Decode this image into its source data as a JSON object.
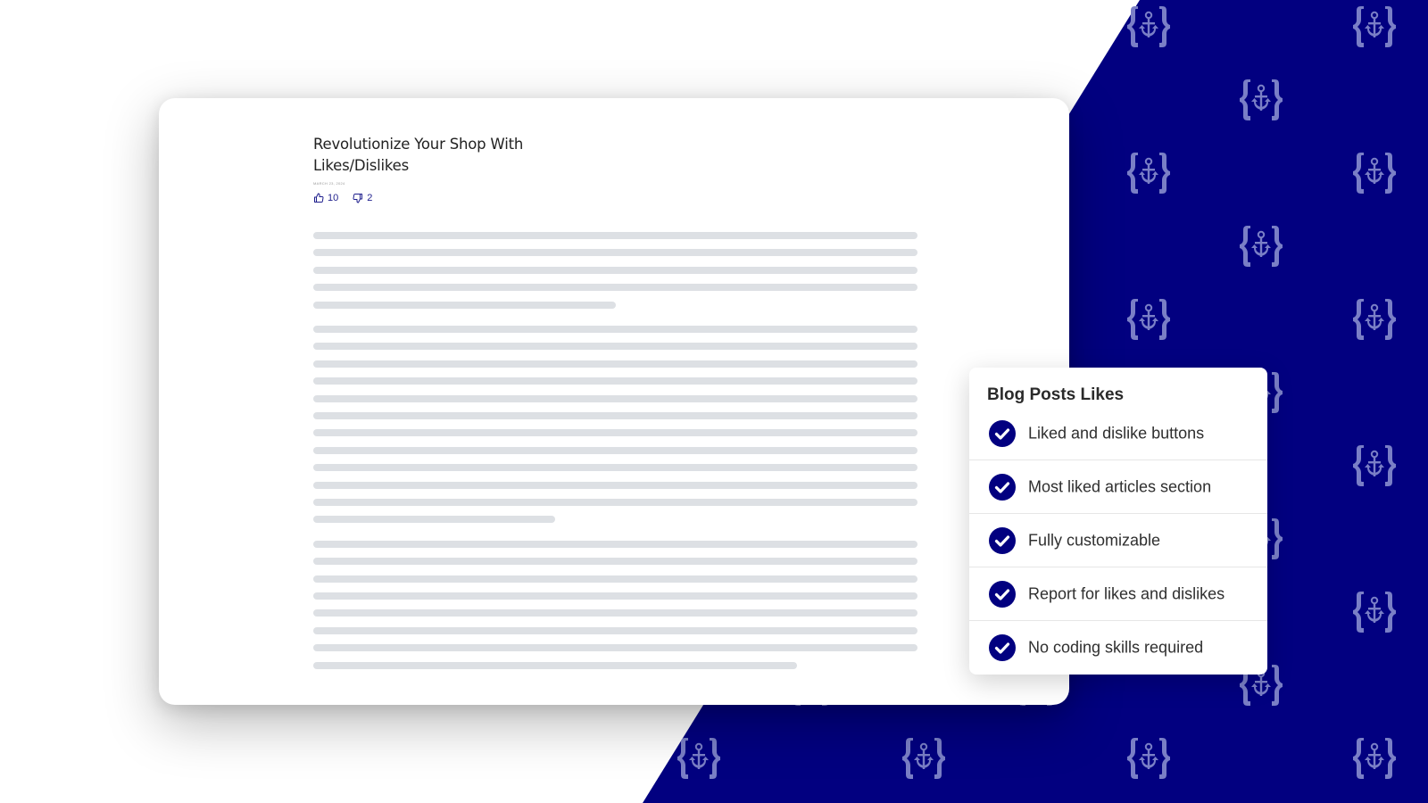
{
  "colors": {
    "navy": "#020080",
    "pattern": "#7a7fc6",
    "accent": "#1e1e8c",
    "placeholder_line": "#dde0e4"
  },
  "background": {
    "pattern_icon": "anchor-in-braces-icon"
  },
  "article": {
    "title": "Revolutionize Your Shop With Likes/Dislikes",
    "date": "MARCH 23, 2024",
    "likes": {
      "icon": "thumbs-up-icon",
      "count": "10"
    },
    "dislikes": {
      "icon": "thumbs-down-icon",
      "count": "2"
    },
    "paragraphs": [
      {
        "lines": 5,
        "last_line_fraction": 0.5
      },
      {
        "lines": 12,
        "last_line_fraction": 0.4
      },
      {
        "lines": 8,
        "last_line_fraction": 0.8
      }
    ]
  },
  "features_card": {
    "title": "Blog Posts Likes",
    "items": [
      {
        "icon": "check-circle-icon",
        "label": "Liked and dislike buttons"
      },
      {
        "icon": "check-circle-icon",
        "label": "Most liked articles section"
      },
      {
        "icon": "check-circle-icon",
        "label": "Fully customizable"
      },
      {
        "icon": "check-circle-icon",
        "label": "Report for likes and dislikes"
      },
      {
        "icon": "check-circle-icon",
        "label": "No coding skills required"
      }
    ]
  }
}
